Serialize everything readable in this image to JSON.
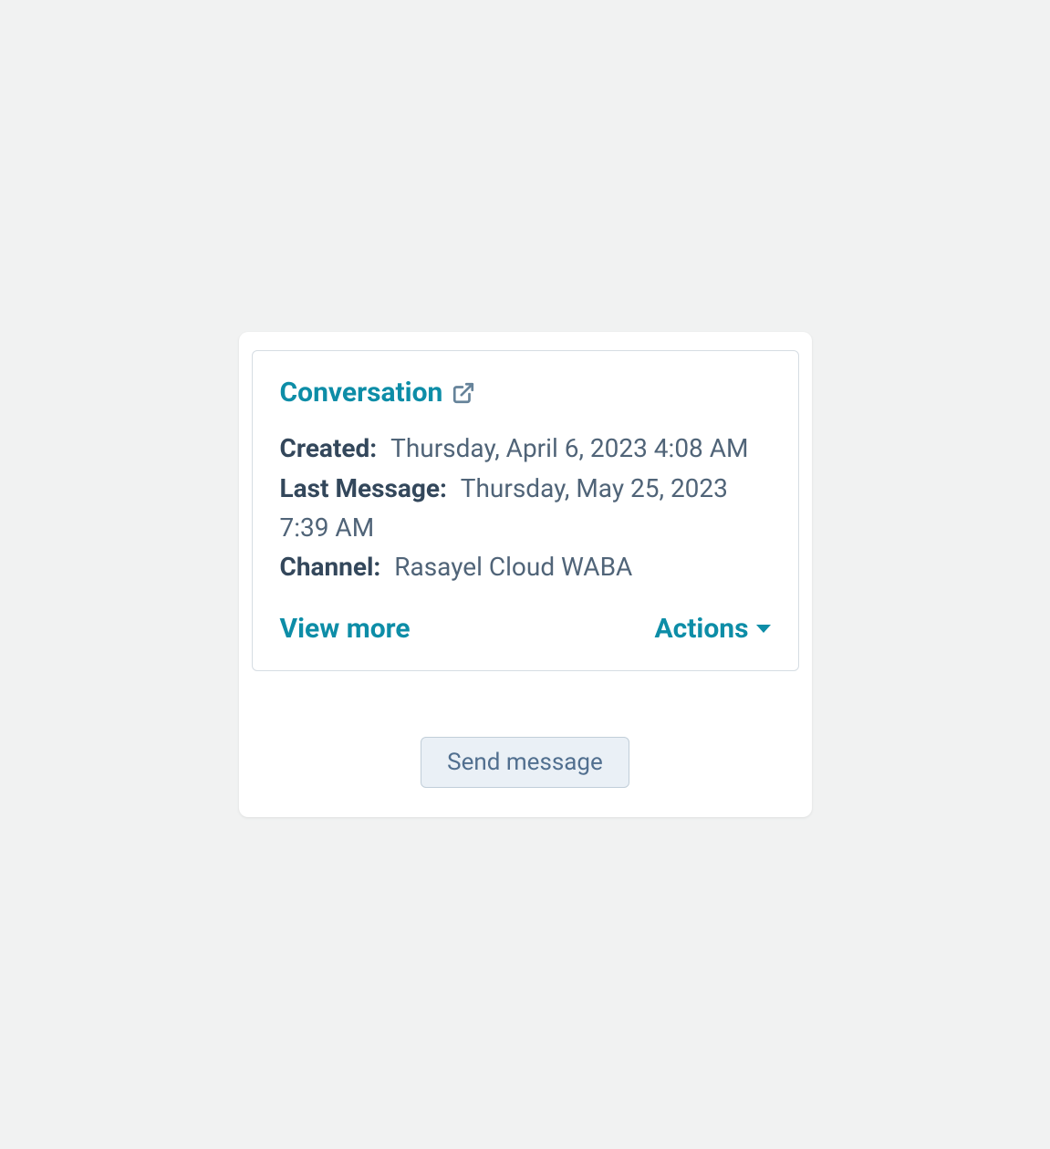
{
  "card": {
    "title": "Conversation",
    "fields": {
      "created_label": "Created:",
      "created_value": "Thursday, April 6, 2023 4:08 AM",
      "last_message_label": "Last Message:",
      "last_message_value": "Thursday, May 25, 2023 7:39 AM",
      "channel_label": "Channel:",
      "channel_value": "Rasayel Cloud WABA"
    },
    "view_more_label": "View more",
    "actions_label": "Actions"
  },
  "send_button_label": "Send message"
}
